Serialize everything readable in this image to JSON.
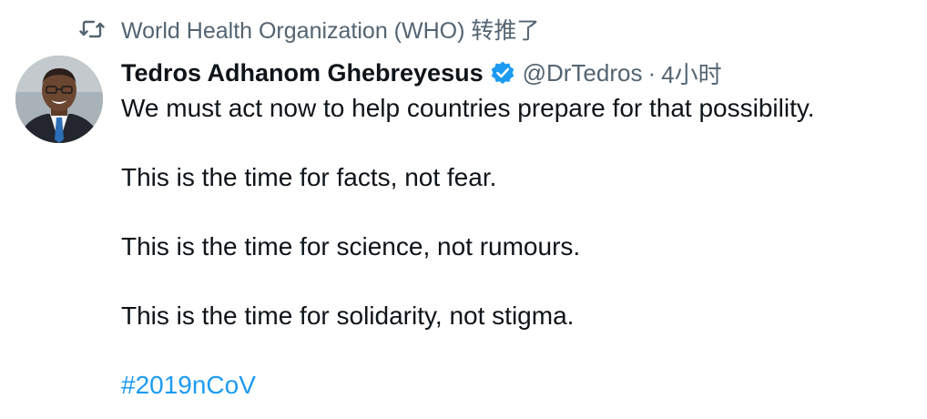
{
  "retweet": {
    "icon": "retweet-icon",
    "account": "World Health Organization (WHO)",
    "suffix": "转推了"
  },
  "tweet": {
    "author": {
      "avatar": "avatar",
      "name": "Tedros Adhanom Ghebreyesus",
      "verified_icon": "verified-badge-icon",
      "handle": "@DrTedros",
      "separator": "·",
      "time": "4小时"
    },
    "lines": [
      "We must act now to help countries prepare for that possibility.",
      "This is the time for facts, not fear.",
      "This is the time for science, not rumours.",
      "This is the time for solidarity, not stigma."
    ],
    "hashtag": "#2019nCoV"
  },
  "colors": {
    "text": "#0f1419",
    "secondary": "#536471",
    "accent": "#1d9bf0"
  }
}
